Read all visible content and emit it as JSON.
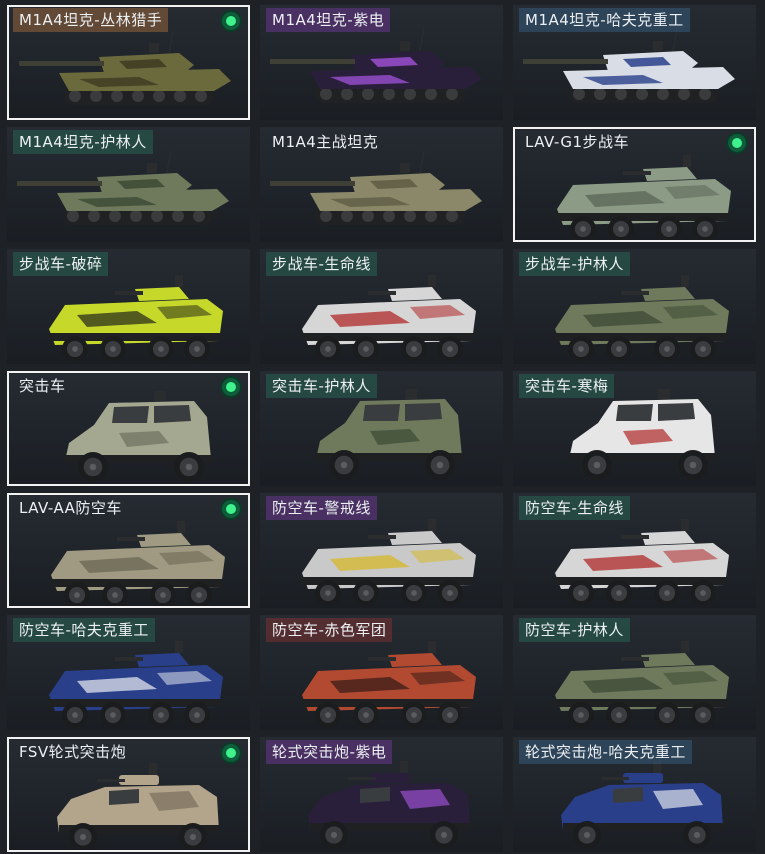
{
  "cards": [
    {
      "label": "M1A4坦克-丛林猎手",
      "tag": "brown",
      "kind": "tank",
      "hull": "#6b6a3c",
      "accent": "#3d3a22",
      "selected": true,
      "badge": true,
      "badge_icon": "equipped-icon"
    },
    {
      "label": "M1A4坦克-紫电",
      "tag": "purple",
      "kind": "tank",
      "hull": "#2a1f3a",
      "accent": "#9a4fd0",
      "selected": false,
      "badge": false
    },
    {
      "label": "M1A4坦克-哈夫克重工",
      "tag": "blue",
      "kind": "tank",
      "hull": "#d8dde6",
      "accent": "#2a3f8a",
      "selected": false,
      "badge": false
    },
    {
      "label": "M1A4坦克-护林人",
      "tag": "green",
      "kind": "tank",
      "hull": "#6f7a5c",
      "accent": "#3c4a35",
      "selected": false,
      "badge": false
    },
    {
      "label": "M1A4主战坦克",
      "tag": "none",
      "kind": "tank",
      "hull": "#8a8868",
      "accent": "#5e5c44",
      "selected": false,
      "badge": false
    },
    {
      "label": "LAV-G1步战车",
      "tag": "none",
      "kind": "ifv",
      "hull": "#8c9b86",
      "accent": "#5a6656",
      "selected": true,
      "badge": true,
      "badge_icon": "equipped-icon"
    },
    {
      "label": "步战车-破碎",
      "tag": "green",
      "kind": "ifv",
      "hull": "#c6d92a",
      "accent": "#2b2f1a",
      "selected": false,
      "badge": false
    },
    {
      "label": "步战车-生命线",
      "tag": "green",
      "kind": "ifv",
      "hull": "#d6d6d6",
      "accent": "#b02a2a",
      "selected": false,
      "badge": false
    },
    {
      "label": "步战车-护林人",
      "tag": "green",
      "kind": "ifv",
      "hull": "#6f7a5c",
      "accent": "#3c4a35",
      "selected": false,
      "badge": false
    },
    {
      "label": "突击车",
      "tag": "none",
      "kind": "mrap",
      "hull": "#a5a890",
      "accent": "#6e705e",
      "selected": true,
      "badge": true,
      "badge_icon": "equipped-icon"
    },
    {
      "label": "突击车-护林人",
      "tag": "green",
      "kind": "mrap",
      "hull": "#6f7a5c",
      "accent": "#3c4a35",
      "selected": false,
      "badge": false
    },
    {
      "label": "突击车-寒梅",
      "tag": "green",
      "kind": "mrap",
      "hull": "#e6e6e6",
      "accent": "#b02a2a",
      "selected": false,
      "badge": false
    },
    {
      "label": "LAV-AA防空车",
      "tag": "none",
      "kind": "ifv",
      "hull": "#a09a82",
      "accent": "#6a6552",
      "selected": true,
      "badge": true,
      "badge_icon": "equipped-icon"
    },
    {
      "label": "防空车-警戒线",
      "tag": "purple",
      "kind": "ifv",
      "hull": "#c9c9c9",
      "accent": "#d6b82a",
      "selected": false,
      "badge": false
    },
    {
      "label": "防空车-生命线",
      "tag": "green",
      "kind": "ifv",
      "hull": "#d6d6d6",
      "accent": "#b02a2a",
      "selected": false,
      "badge": false
    },
    {
      "label": "防空车-哈夫克重工",
      "tag": "green",
      "kind": "ifv",
      "hull": "#2a3f8a",
      "accent": "#e0e4ec",
      "selected": false,
      "badge": false
    },
    {
      "label": "防空车-赤色军团",
      "tag": "red",
      "kind": "ifv",
      "hull": "#b24a32",
      "accent": "#3a1e18",
      "selected": false,
      "badge": false
    },
    {
      "label": "防空车-护林人",
      "tag": "green",
      "kind": "ifv",
      "hull": "#6f7a5c",
      "accent": "#3c4a35",
      "selected": false,
      "badge": false
    },
    {
      "label": "FSV轮式突击炮",
      "tag": "none",
      "kind": "fsv",
      "hull": "#b3a58c",
      "accent": "#7a6f5c",
      "selected": true,
      "badge": true,
      "badge_icon": "equipped-icon"
    },
    {
      "label": "轮式突击炮-紫电",
      "tag": "purple",
      "kind": "fsv",
      "hull": "#2a1f3a",
      "accent": "#9a4fd0",
      "selected": false,
      "badge": false
    },
    {
      "label": "轮式突击炮-哈夫克重工",
      "tag": "blue",
      "kind": "fsv",
      "hull": "#2a3f8a",
      "accent": "#e0e4ec",
      "selected": false,
      "badge": false
    }
  ]
}
